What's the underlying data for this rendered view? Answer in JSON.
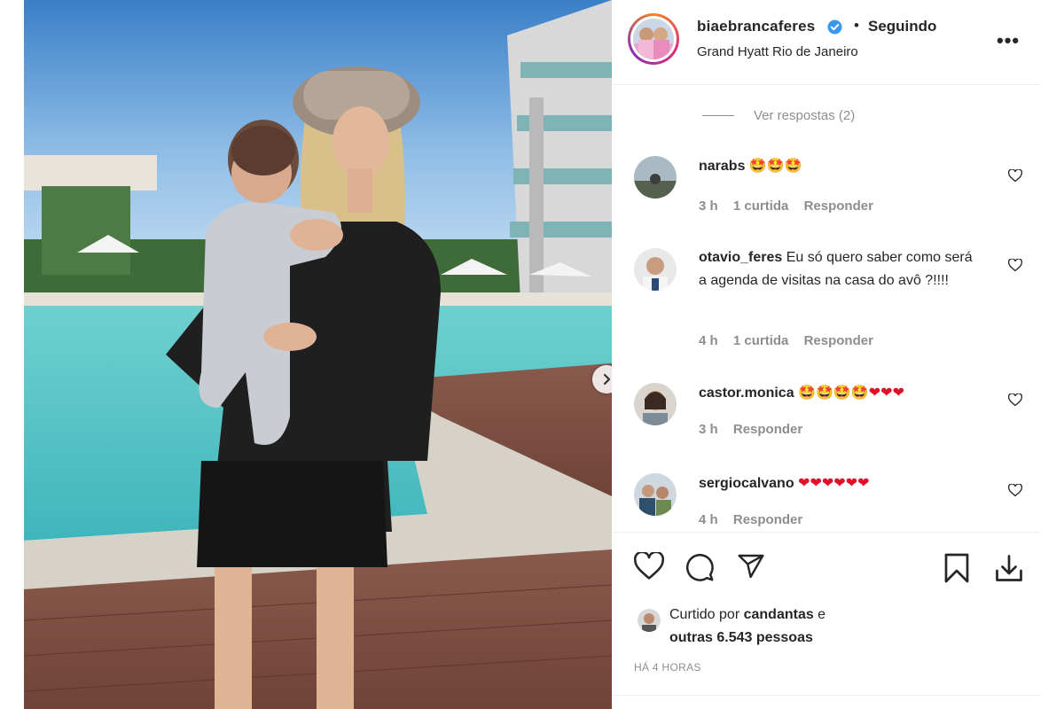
{
  "post": {
    "username": "biaebrancaferes",
    "separator": "•",
    "follow_status": "Seguindo",
    "location": "Grand Hyatt Rio de Janeiro",
    "more_label": "•••"
  },
  "replies_label": "Ver respostas (2)",
  "comments": [
    {
      "user": "narabs",
      "text": "",
      "emoji": "🤩🤩🤩",
      "time": "3 h",
      "likes": "1 curtida",
      "reply": "Responder"
    },
    {
      "user": "otavio_feres",
      "text": "Eu só quero saber como será a agenda de visitas na casa do avô ?!!!!",
      "emoji": "",
      "time": "4 h",
      "likes": "1 curtida",
      "reply": "Responder"
    },
    {
      "user": "castor.monica",
      "text": "",
      "emoji": "🤩🤩🤩🤩❤❤❤",
      "time": "3 h",
      "likes": "",
      "reply": "Responder"
    },
    {
      "user": "sergiocalvano",
      "text": "",
      "emoji": "❤❤❤❤❤❤",
      "time": "4 h",
      "likes": "",
      "reply": "Responder"
    }
  ],
  "liked_by": {
    "prefix": "Curtido por ",
    "user": "candantas",
    "middle": " e",
    "others": "outras 6.543 pessoas"
  },
  "timestamp": "HÁ 4 HORAS",
  "icons": [
    "heart-icon",
    "comment-icon",
    "share-icon",
    "bookmark-icon",
    "download-icon",
    "chevron-right-icon",
    "verified-icon"
  ],
  "colors": {
    "verified": "#3897f0",
    "heart": "#e0102a",
    "muted": "#8e8e8e",
    "text": "#262626"
  }
}
